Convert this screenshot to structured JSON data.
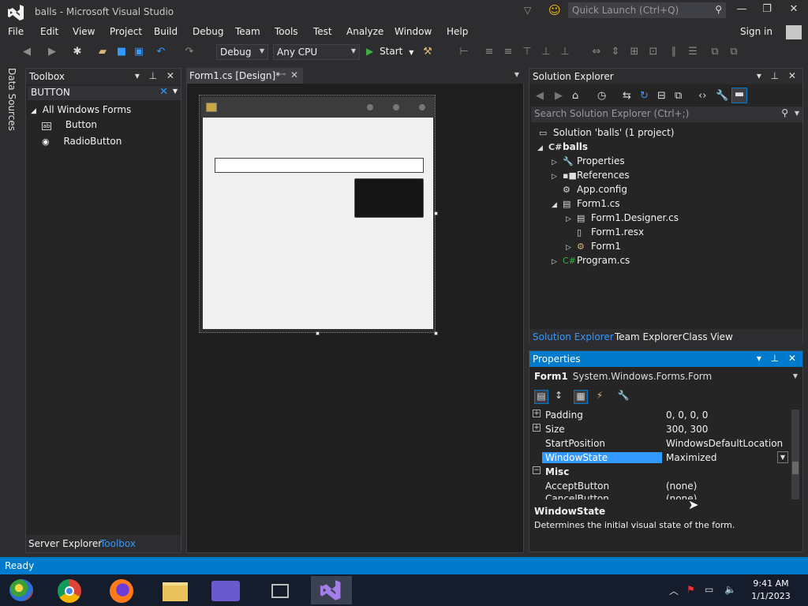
{
  "window": {
    "title": "balls - Microsoft Visual Studio",
    "quick_launch_placeholder": "Quick Launch (Ctrl+Q)",
    "sign_in": "Sign in"
  },
  "menu": [
    "File",
    "Edit",
    "View",
    "Project",
    "Build",
    "Debug",
    "Team",
    "Tools",
    "Test",
    "Analyze",
    "Window",
    "Help"
  ],
  "toolbar": {
    "config": "Debug",
    "platform": "Any CPU",
    "start_label": "Start"
  },
  "left_vertical_tab": "Data Sources",
  "toolbox": {
    "title": "Toolbox",
    "search_value": "BUTTON",
    "group": "All Windows Forms",
    "items": [
      "Button",
      "RadioButton"
    ],
    "bottom_tabs": [
      "Server Explorer",
      "Toolbox"
    ]
  },
  "designer": {
    "tab_label": "Form1.cs [Design]*",
    "form_label_lines": [
      "",
      "",
      ""
    ]
  },
  "solution_explorer": {
    "title": "Solution Explorer",
    "search_placeholder": "Search Solution Explorer (Ctrl+;)",
    "solution": "Solution 'balls' (1 project)",
    "project": "balls",
    "nodes": [
      "Properties",
      "References",
      "App.config",
      "Form1.cs",
      "Form1.Designer.cs",
      "Form1.resx",
      "Form1",
      "Program.cs"
    ],
    "tabs": [
      "Solution Explorer",
      "Team Explorer",
      "Class View"
    ]
  },
  "properties": {
    "title": "Properties",
    "object_name": "Form1",
    "object_type": "System.Windows.Forms.Form",
    "rows": [
      {
        "name": "Padding",
        "value": "0, 0, 0, 0"
      },
      {
        "name": "Size",
        "value": "300, 300"
      },
      {
        "name": "StartPosition",
        "value": "WindowsDefaultLocation"
      },
      {
        "name": "WindowState",
        "value": "Maximized"
      },
      {
        "name": "Misc",
        "value": ""
      },
      {
        "name": "AcceptButton",
        "value": "(none)"
      },
      {
        "name": "CancelButton",
        "value": "(none)"
      }
    ],
    "description_title": "WindowState",
    "description": "Determines the initial visual state of the form."
  },
  "status": "Ready",
  "clock": {
    "time": "9:41 AM",
    "date": "1/1/2023"
  },
  "colors": {
    "accent": "#007acc",
    "background": "#2d2d30",
    "panel": "#252526",
    "link": "#3399ff"
  }
}
